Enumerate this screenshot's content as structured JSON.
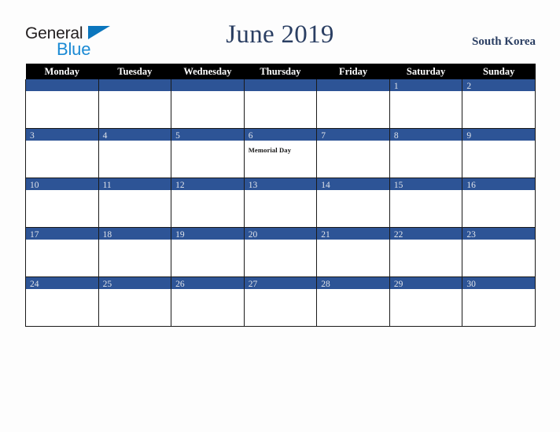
{
  "header": {
    "logo_text_top": "General",
    "logo_text_bottom": "Blue",
    "logo_triangle_icon": "triangle-icon",
    "month_title": "June 2019",
    "country": "South Korea"
  },
  "colors": {
    "day_band_blue": "#2D5496",
    "header_black": "#000000",
    "title_navy": "#2B3F63",
    "logo_blue": "#1B8AD4",
    "page_background": "#FDFDFD"
  },
  "calendar": {
    "month": "June",
    "year": "2019",
    "weekday_headers": [
      "Monday",
      "Tuesday",
      "Wednesday",
      "Thursday",
      "Friday",
      "Saturday",
      "Sunday"
    ],
    "weeks": [
      [
        {
          "day": "",
          "event": ""
        },
        {
          "day": "",
          "event": ""
        },
        {
          "day": "",
          "event": ""
        },
        {
          "day": "",
          "event": ""
        },
        {
          "day": "",
          "event": ""
        },
        {
          "day": "1",
          "event": ""
        },
        {
          "day": "2",
          "event": ""
        }
      ],
      [
        {
          "day": "3",
          "event": ""
        },
        {
          "day": "4",
          "event": ""
        },
        {
          "day": "5",
          "event": ""
        },
        {
          "day": "6",
          "event": "Memorial Day"
        },
        {
          "day": "7",
          "event": ""
        },
        {
          "day": "8",
          "event": ""
        },
        {
          "day": "9",
          "event": ""
        }
      ],
      [
        {
          "day": "10",
          "event": ""
        },
        {
          "day": "11",
          "event": ""
        },
        {
          "day": "12",
          "event": ""
        },
        {
          "day": "13",
          "event": ""
        },
        {
          "day": "14",
          "event": ""
        },
        {
          "day": "15",
          "event": ""
        },
        {
          "day": "16",
          "event": ""
        }
      ],
      [
        {
          "day": "17",
          "event": ""
        },
        {
          "day": "18",
          "event": ""
        },
        {
          "day": "19",
          "event": ""
        },
        {
          "day": "20",
          "event": ""
        },
        {
          "day": "21",
          "event": ""
        },
        {
          "day": "22",
          "event": ""
        },
        {
          "day": "23",
          "event": ""
        }
      ],
      [
        {
          "day": "24",
          "event": ""
        },
        {
          "day": "25",
          "event": ""
        },
        {
          "day": "26",
          "event": ""
        },
        {
          "day": "27",
          "event": ""
        },
        {
          "day": "28",
          "event": ""
        },
        {
          "day": "29",
          "event": ""
        },
        {
          "day": "30",
          "event": ""
        }
      ]
    ],
    "holidays": [
      {
        "date": "6",
        "name": "Memorial Day"
      }
    ]
  }
}
